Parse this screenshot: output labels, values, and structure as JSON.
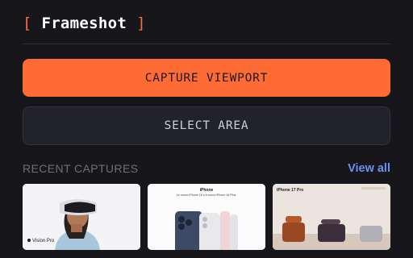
{
  "header": {
    "bracket_left": "[",
    "app_name": "Frameshot",
    "bracket_right": "]"
  },
  "actions": {
    "capture_viewport": "CAPTURE VIEWPORT",
    "select_area": "SELECT AREA"
  },
  "recent": {
    "title": "RECENT CAPTURES",
    "view_all": "View all",
    "items": [
      {
        "caption": "Vision Pro",
        "icon": "apple-logo"
      },
      {
        "caption": "iPhone",
        "subtitle": "Le nuovo iPhone 16 e il nuovo iPhone 16 Plus."
      },
      {
        "caption": "iPhone 17 Pro"
      }
    ]
  },
  "colors": {
    "background": "#16161b",
    "accent": "#ff6b35",
    "link": "#6b8ff2",
    "muted": "#6f6f7c"
  }
}
